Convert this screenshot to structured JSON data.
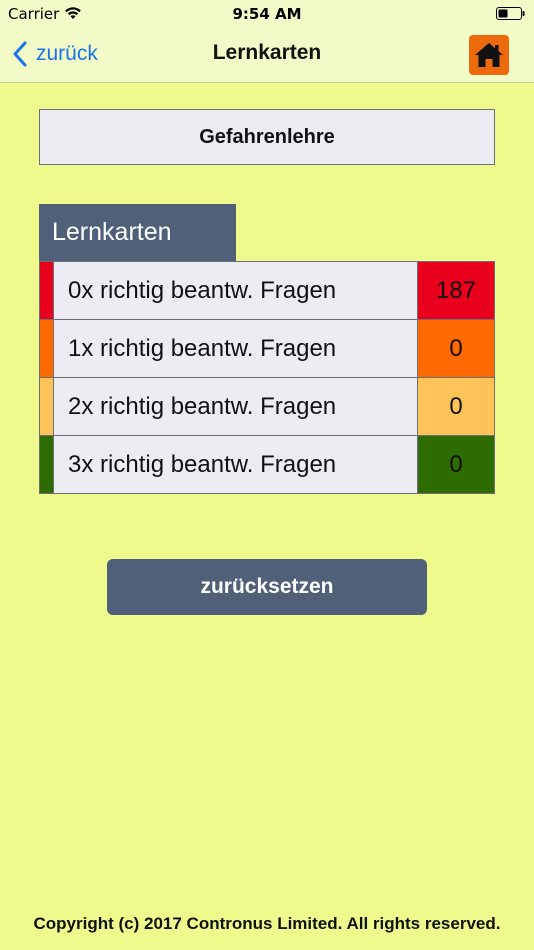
{
  "status_bar": {
    "carrier": "Carrier",
    "time": "9:54 AM",
    "wifi_icon": "wifi-icon",
    "battery_icon": "battery-icon"
  },
  "nav": {
    "back_label": "zurück",
    "title": "Lernkarten",
    "home_icon": "home-icon",
    "accent_color": "#1a73e8",
    "home_color": "#ed6a0c"
  },
  "category": {
    "title": "Gefahrenlehre"
  },
  "cards": {
    "header": "Lernkarten",
    "rows": [
      {
        "label": "0x richtig beantw. Fragen",
        "count": "187",
        "color": "#e8001c"
      },
      {
        "label": "1x richtig beantw. Fragen",
        "count": "0",
        "color": "#ff6a00"
      },
      {
        "label": "2x richtig beantw. Fragen",
        "count": "0",
        "color": "#ffc35a"
      },
      {
        "label": "3x richtig beantw. Fragen",
        "count": "0",
        "color": "#2e6b00"
      }
    ]
  },
  "actions": {
    "reset_label": "zurücksetzen"
  },
  "footer": {
    "copyright": "Copyright (c) 2017 Contronus Limited. All rights reserved."
  },
  "colors": {
    "background": "#eefb8c",
    "header_bg": "#506079"
  }
}
